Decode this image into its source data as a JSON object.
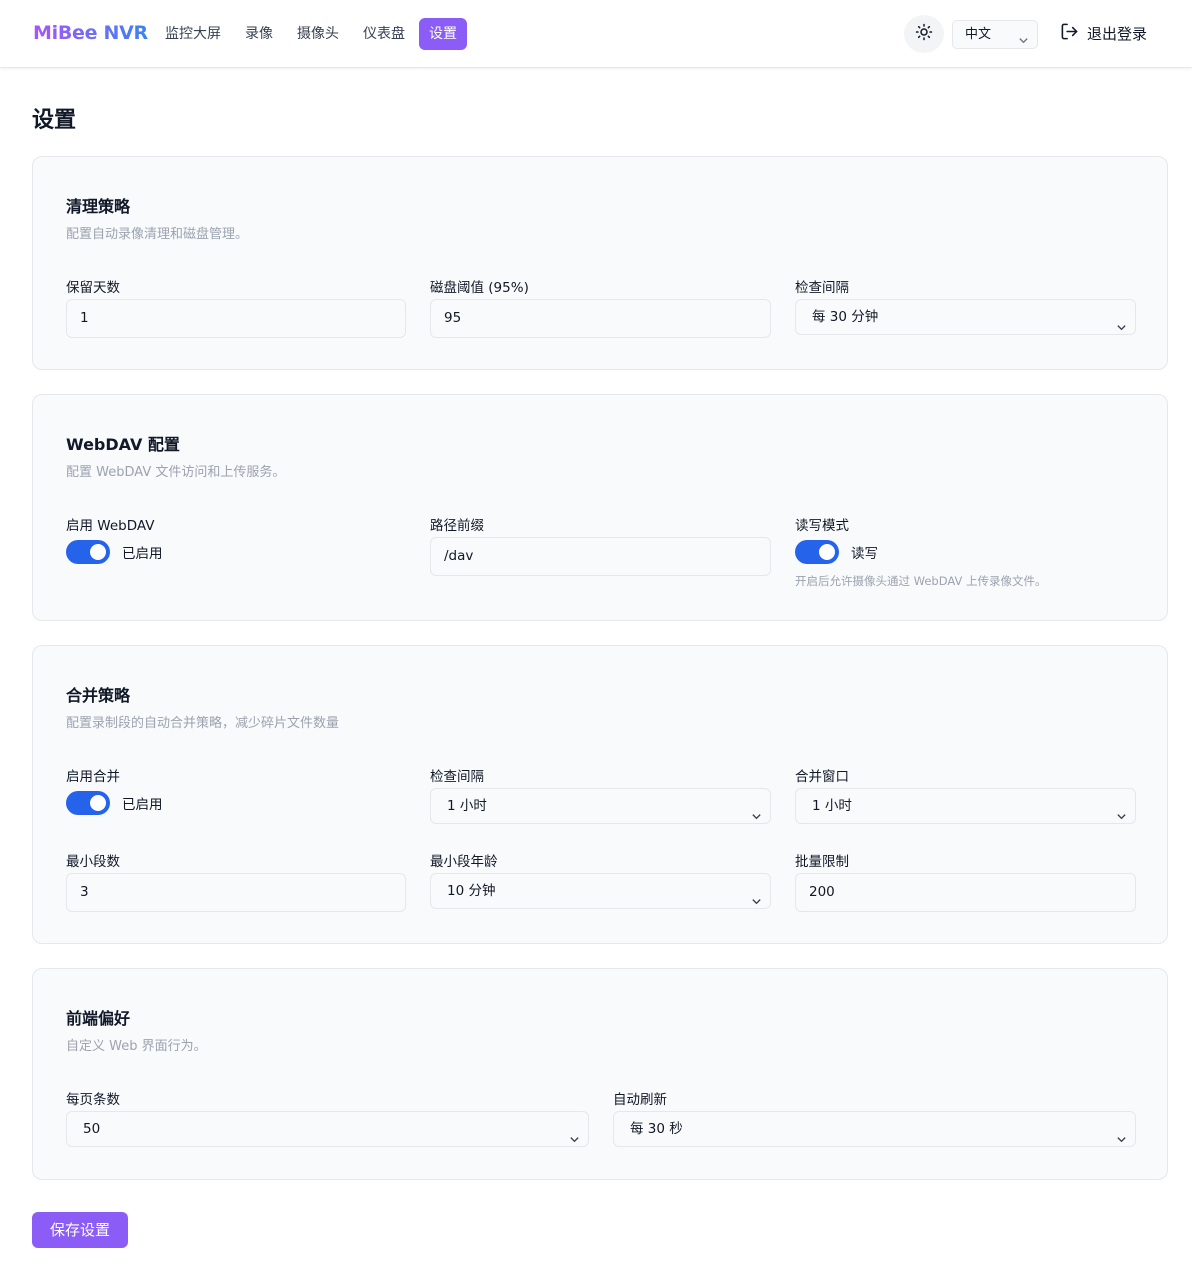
{
  "header": {
    "brand": "MiBee NVR",
    "nav": [
      {
        "label": "监控大屏",
        "active": false
      },
      {
        "label": "录像",
        "active": false
      },
      {
        "label": "摄像头",
        "active": false
      },
      {
        "label": "仪表盘",
        "active": false
      },
      {
        "label": "设置",
        "active": true
      }
    ],
    "theme_icon": "sun-icon",
    "language": "中文",
    "logout_label": "退出登录",
    "logout_icon": "logout-icon"
  },
  "page": {
    "title": "设置"
  },
  "cleanup": {
    "title": "清理策略",
    "desc": "配置自动录像清理和磁盘管理。",
    "retention_label": "保留天数",
    "retention_value": "1",
    "disk_label": "磁盘阈值 (95%)",
    "disk_value": "95",
    "interval_label": "检查间隔",
    "interval_value": "每 30 分钟"
  },
  "webdav": {
    "title": "WebDAV 配置",
    "desc": "配置 WebDAV 文件访问和上传服务。",
    "enable_label": "启用 WebDAV",
    "enable_state": "已启用",
    "prefix_label": "路径前缀",
    "prefix_value": "/dav",
    "mode_label": "读写模式",
    "mode_state": "读写",
    "mode_hint": "开启后允许摄像头通过 WebDAV 上传录像文件。"
  },
  "merge": {
    "title": "合并策略",
    "desc": "配置录制段的自动合并策略，减少碎片文件数量",
    "enable_label": "启用合并",
    "enable_state": "已启用",
    "interval_label": "检查间隔",
    "interval_value": "1 小时",
    "window_label": "合并窗口",
    "window_value": "1 小时",
    "min_segments_label": "最小段数",
    "min_segments_value": "3",
    "min_age_label": "最小段年龄",
    "min_age_value": "10 分钟",
    "batch_label": "批量限制",
    "batch_value": "200"
  },
  "frontend": {
    "title": "前端偏好",
    "desc": "自定义 Web 界面行为。",
    "page_size_label": "每页条数",
    "page_size_value": "50",
    "refresh_label": "自动刷新",
    "refresh_value": "每 30 秒"
  },
  "save_label": "保存设置",
  "colors": {
    "accent": "#8b5cf6",
    "toggle_on": "#2563eb",
    "card_bg": "#f8fafc",
    "muted_text": "#9ca3af"
  }
}
